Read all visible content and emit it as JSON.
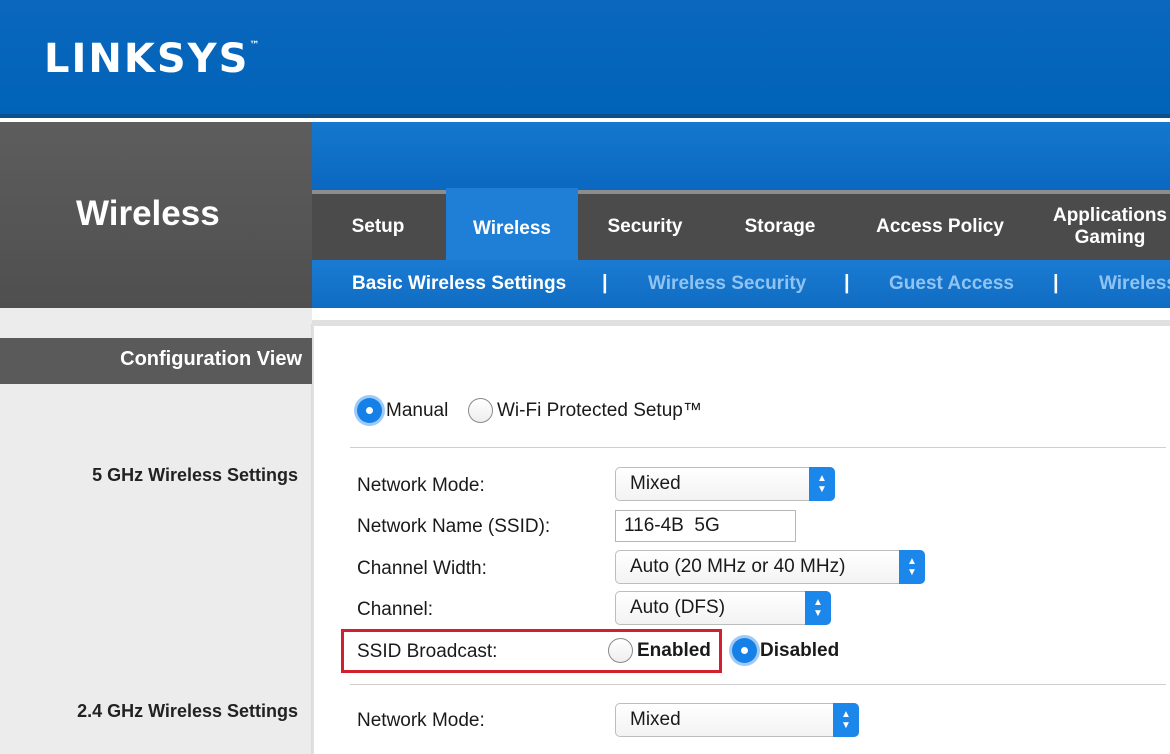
{
  "brand": {
    "logo": "LINKSYS",
    "trademark": "™"
  },
  "section_title": "Wireless",
  "tabs": [
    {
      "label": "Setup",
      "active": false
    },
    {
      "label": "Wireless",
      "active": true
    },
    {
      "label": "Security",
      "active": false
    },
    {
      "label": "Storage",
      "active": false
    },
    {
      "label": "Access Policy",
      "active": false
    },
    {
      "label": "Applications Gaming",
      "active": false
    }
  ],
  "subtabs": [
    {
      "label": "Basic Wireless Settings",
      "active": true
    },
    {
      "label": "Wireless Security",
      "active": false
    },
    {
      "label": "Guest Access",
      "active": false
    },
    {
      "label": "Wireless",
      "active": false
    }
  ],
  "subtab_separator": "|",
  "sidebar": {
    "config_view": "Configuration View",
    "section_5ghz": "5 GHz Wireless Settings",
    "section_24ghz": "2.4 GHz Wireless Settings"
  },
  "setup_mode": {
    "manual": "Manual",
    "wps": "Wi-Fi Protected Setup™",
    "selected": "Manual"
  },
  "five_ghz": {
    "network_mode_label": "Network Mode:",
    "network_mode_value": "Mixed",
    "ssid_label": "Network Name (SSID):",
    "ssid_value": "116-4B  5G",
    "channel_width_label": "Channel Width:",
    "channel_width_value": "Auto (20 MHz or 40 MHz)",
    "channel_label": "Channel:",
    "channel_value": "Auto (DFS)",
    "ssid_broadcast_label": "SSID Broadcast:",
    "ssid_broadcast_enabled": "Enabled",
    "ssid_broadcast_disabled": "Disabled",
    "ssid_broadcast_selected": "Disabled"
  },
  "two_four_ghz": {
    "network_mode_label": "Network Mode:",
    "network_mode_value": "Mixed"
  },
  "colors": {
    "brand_blue": "#0063b8",
    "tab_active": "#1f7fd6",
    "highlight_red": "#d3202f"
  }
}
